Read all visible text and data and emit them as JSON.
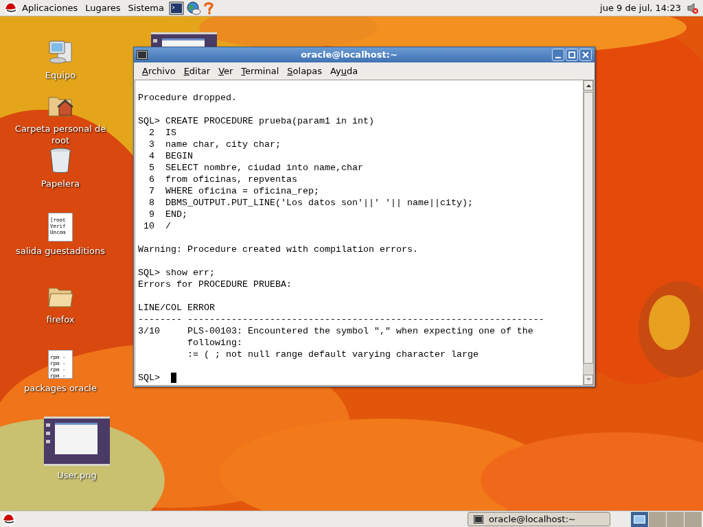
{
  "top_panel": {
    "menus": [
      "Aplicaciones",
      "Lugares",
      "Sistema"
    ],
    "clock": "jue  9 de jul, 14:23"
  },
  "desktop_icons": [
    {
      "kind": "computer",
      "label": "Equipo"
    },
    {
      "kind": "home",
      "label": "Carpeta personal de root"
    },
    {
      "kind": "trash",
      "label": "Papelera"
    },
    {
      "kind": "textfile",
      "label": "salida guestaditions",
      "preview": [
        "[root",
        "Verif",
        "Uncom"
      ]
    },
    {
      "kind": "folder",
      "label": "firefox"
    },
    {
      "kind": "textfile",
      "label": "packages oracle",
      "preview": [
        "rpm -",
        "rpm -",
        "rpm -",
        "rpm -"
      ]
    },
    {
      "label": "User.png"
    }
  ],
  "window": {
    "title": "oracle@localhost:~",
    "menu": [
      {
        "key": "A",
        "after": "rchivo"
      },
      {
        "key": "E",
        "after": "ditar"
      },
      {
        "key": "V",
        "after": "er"
      },
      {
        "key": "T",
        "after": "erminal"
      },
      {
        "key": "S",
        "after": "olapas"
      },
      {
        "before": "Ay",
        "key": "u",
        "after": "da"
      }
    ],
    "blocks": [
      [
        "Procedure dropped."
      ],
      [
        "SQL> CREATE PROCEDURE prueba(param1 in int)",
        "  2  IS",
        "  3  name char, city char;",
        "  4  BEGIN",
        "  5  SELECT nombre, ciudad into name,char",
        "  6  from oficinas, repventas",
        "  7  WHERE oficina = oficina_rep;",
        "  8  DBMS_OUTPUT.PUT_LINE('Los datos son'||' '|| name||city);",
        "  9  END;",
        " 10  /"
      ],
      [
        "Warning: Procedure created with compilation errors."
      ],
      [
        "SQL> show err;",
        "Errors for PROCEDURE PRUEBA:"
      ],
      [
        "LINE/COL ERROR",
        "-------- -----------------------------------------------------------------",
        "3/10     PLS-00103: Encountered the symbol \",\" when expecting one of the",
        "         following:",
        "         := ( ; not null range default varying character large"
      ]
    ],
    "prompt": "SQL>"
  },
  "taskbar": {
    "tasks": [
      {
        "label": "oracle@localhost:~"
      }
    ],
    "workspaces": [
      {
        "selected": true
      },
      {
        "selected": false
      },
      {
        "selected": false
      },
      {
        "selected": false
      }
    ]
  }
}
